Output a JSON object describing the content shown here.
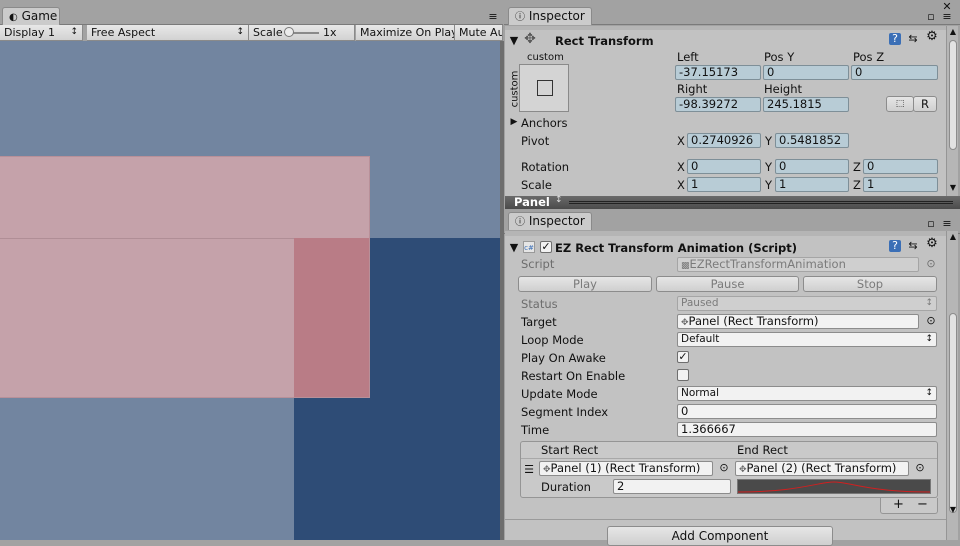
{
  "game": {
    "tab_label": "Game",
    "toolbar": {
      "display": "Display 1",
      "aspect": "Free Aspect",
      "scale_label": "Scale",
      "scale_value": "1x",
      "maximize": "Maximize On Play",
      "mute": "Mute Au"
    }
  },
  "inspector1": {
    "tab_label": "Inspector",
    "component_title": "Rect Transform",
    "anchor_preset_top": "custom",
    "anchor_preset_side": "custom",
    "headers": {
      "left": "Left",
      "pos_y": "Pos Y",
      "pos_z": "Pos Z",
      "right": "Right",
      "height": "Height"
    },
    "values": {
      "left": "-37.15173",
      "pos_y": "0",
      "pos_z": "0",
      "right": "-98.39272",
      "height": "245.1815"
    },
    "raw_button": "R",
    "anchors_label": "Anchors",
    "pivot_label": "Pivot",
    "pivot": {
      "x_label": "X",
      "x": "0.2740926",
      "y_label": "Y",
      "y": "0.5481852"
    },
    "rotation_label": "Rotation",
    "rotation": {
      "x_label": "X",
      "x": "0",
      "y_label": "Y",
      "y": "0",
      "z_label": "Z",
      "z": "0"
    },
    "scale_label": "Scale",
    "scale": {
      "x_label": "X",
      "x": "1",
      "y_label": "Y",
      "y": "1",
      "z_label": "Z",
      "z": "1"
    },
    "object_name": "Panel"
  },
  "inspector2": {
    "tab_label": "Inspector",
    "component_title": "EZ Rect Transform Animation (Script)",
    "script_label": "Script",
    "script_value": "EZRectTransformAnimation",
    "play_button": "Play",
    "pause_button": "Pause",
    "stop_button": "Stop",
    "status_label": "Status",
    "status_value": "Paused",
    "target_label": "Target",
    "target_value": "Panel (Rect Transform)",
    "loop_mode_label": "Loop Mode",
    "loop_mode_value": "Default",
    "play_on_awake_label": "Play On Awake",
    "restart_on_enable_label": "Restart On Enable",
    "update_mode_label": "Update Mode",
    "update_mode_value": "Normal",
    "segment_index_label": "Segment Index",
    "segment_index_value": "0",
    "time_label": "Time",
    "time_value": "1.366667",
    "list": {
      "start_rect_header": "Start Rect",
      "end_rect_header": "End Rect",
      "start_rect_value": "Panel (1) (Rect Transform)",
      "end_rect_value": "Panel (2) (Rect Transform)",
      "duration_label": "Duration",
      "duration_value": "2",
      "add_symbol": "+",
      "remove_symbol": "−"
    },
    "add_component_button": "Add Component"
  },
  "colors": {
    "game_bg": "#7285a0",
    "dark_panel": "#2e4c76",
    "pink_panel": "#c5a2aa",
    "overlap": "#b97c86",
    "field_blue": "#b8ccd6"
  }
}
